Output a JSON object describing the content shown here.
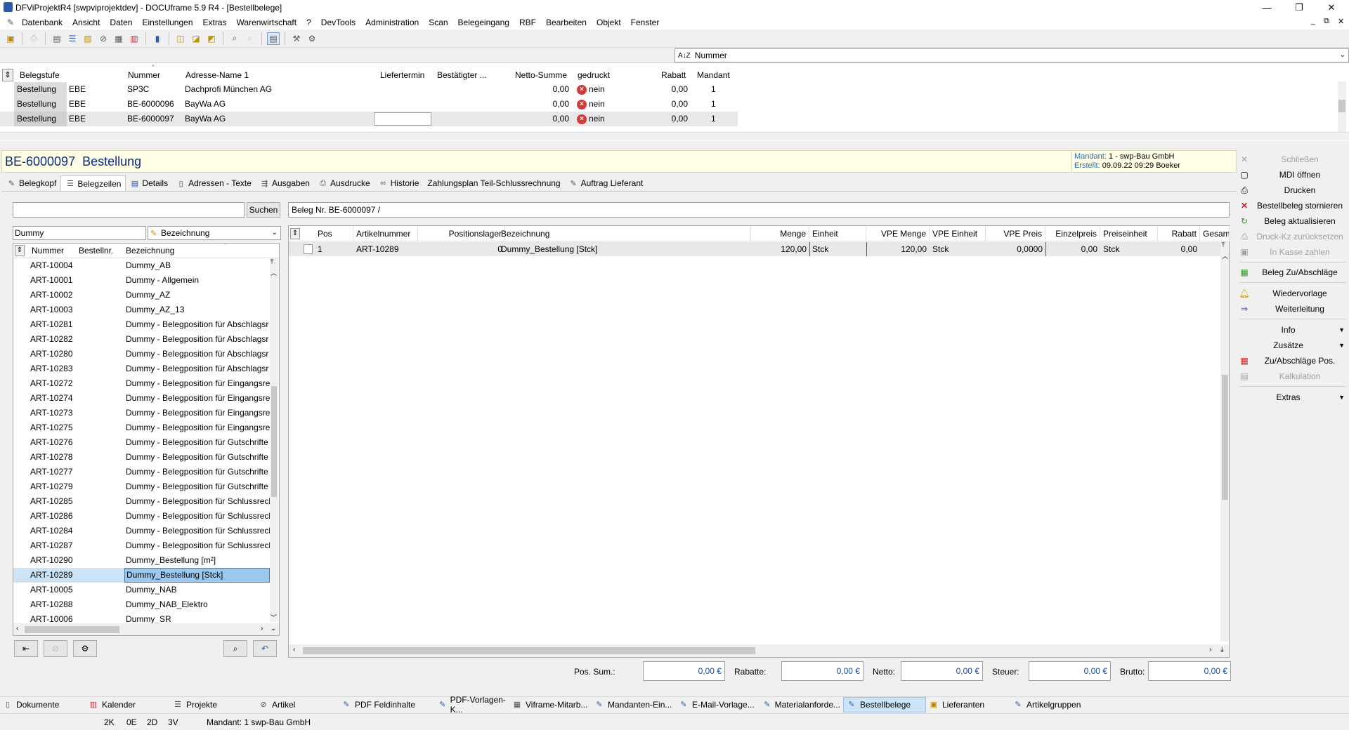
{
  "window": {
    "title": "DFViProjektR4 [swpviprojektdev] - DOCUframe 5.9 R4 - [Bestellbelege]",
    "minimize": "—",
    "maximize": "❐",
    "close": "✕",
    "inner_minimize": "_",
    "inner_restore": "⧉",
    "inner_close": "✕"
  },
  "menu": [
    "Datenbank",
    "Ansicht",
    "Daten",
    "Einstellungen",
    "Extras",
    "Warenwirtschaft",
    "?",
    "DevTools",
    "Administration",
    "Scan",
    "Belegeingang",
    "RBF",
    "Bearbeiten",
    "Objekt",
    "Fenster"
  ],
  "sortbar": {
    "label": "Nummer",
    "icon": "sort-az-icon"
  },
  "toplist": {
    "headers": [
      "Belegstufe",
      "Nummer",
      "Adresse-Name 1",
      "Liefertermin",
      "Bestätigter ...",
      "Netto-Summe",
      "gedruckt",
      "Rabatt",
      "Mandant"
    ],
    "rows": [
      {
        "stufe": "Bestellung",
        "typ": "EBE",
        "nummer": "SP3C",
        "adresse": "Dachprofi München AG",
        "liefertermin": "",
        "bestaetigt": "",
        "netto": "0,00",
        "gedruckt": "nein",
        "rabatt": "0,00",
        "mandant": "1"
      },
      {
        "stufe": "Bestellung",
        "typ": "EBE",
        "nummer": "BE-6000096",
        "adresse": "BayWa AG",
        "liefertermin": "",
        "bestaetigt": "",
        "netto": "0,00",
        "gedruckt": "nein",
        "rabatt": "0,00",
        "mandant": "1"
      },
      {
        "stufe": "Bestellung",
        "typ": "EBE",
        "nummer": "BE-6000097",
        "adresse": "BayWa AG",
        "liefertermin": "",
        "bestaetigt": "",
        "netto": "0,00",
        "gedruckt": "nein",
        "rabatt": "0,00",
        "mandant": "1"
      }
    ]
  },
  "beleg": {
    "nummer": "BE-6000097",
    "stufe": "Bestellung",
    "mandant_label": "Mandant:",
    "mandant_value": "1 - swp-Bau GmbH",
    "erstellt_label": "Erstellt:",
    "erstellt_value": "09.09.22 09:29  Boeker"
  },
  "tabs": [
    {
      "label": "Belegkopf",
      "icon": "pencil-icon"
    },
    {
      "label": "Belegzeilen",
      "icon": "lines-icon"
    },
    {
      "label": "Details",
      "icon": "details-icon"
    },
    {
      "label": "Adressen - Texte",
      "icon": "page-icon"
    },
    {
      "label": "Ausgaben",
      "icon": "output-icon"
    },
    {
      "label": "Ausdrucke",
      "icon": "printer-icon"
    },
    {
      "label": "Historie",
      "icon": "link-icon"
    },
    {
      "label": "Zahlungsplan Teil-Schlussrechnung",
      "icon": ""
    },
    {
      "label": "Auftrag Lieferant",
      "icon": "edit-icon"
    }
  ],
  "search": {
    "value": "",
    "button": "Suchen",
    "beleg_field": "Beleg Nr. BE-6000097 /"
  },
  "filter": {
    "value": "Dummy",
    "field_select": "Bezeichnung"
  },
  "leftlist": {
    "headers": [
      "Nummer",
      "Bestellnr.",
      "Bezeichnung"
    ],
    "rows": [
      [
        "ART-10004",
        "",
        "Dummy_AB"
      ],
      [
        "ART-10001",
        "",
        "Dummy - Allgemein"
      ],
      [
        "ART-10002",
        "",
        "Dummy_AZ"
      ],
      [
        "ART-10003",
        "",
        "Dummy_AZ_13"
      ],
      [
        "ART-10281",
        "",
        "Dummy - Belegposition für Abschlagsr"
      ],
      [
        "ART-10282",
        "",
        "Dummy - Belegposition für Abschlagsr"
      ],
      [
        "ART-10280",
        "",
        "Dummy - Belegposition für Abschlagsr"
      ],
      [
        "ART-10283",
        "",
        "Dummy - Belegposition für Abschlagsr"
      ],
      [
        "ART-10272",
        "",
        "Dummy - Belegposition für Eingangsre"
      ],
      [
        "ART-10274",
        "",
        "Dummy - Belegposition für Eingangsre"
      ],
      [
        "ART-10273",
        "",
        "Dummy - Belegposition für Eingangsre"
      ],
      [
        "ART-10275",
        "",
        "Dummy - Belegposition für Eingangsre"
      ],
      [
        "ART-10276",
        "",
        "Dummy - Belegposition für Gutschrifte"
      ],
      [
        "ART-10278",
        "",
        "Dummy - Belegposition für Gutschrifte"
      ],
      [
        "ART-10277",
        "",
        "Dummy - Belegposition für Gutschrifte"
      ],
      [
        "ART-10279",
        "",
        "Dummy - Belegposition für Gutschrifte"
      ],
      [
        "ART-10285",
        "",
        "Dummy - Belegposition für Schlussrech"
      ],
      [
        "ART-10286",
        "",
        "Dummy - Belegposition für Schlussrech"
      ],
      [
        "ART-10284",
        "",
        "Dummy - Belegposition für Schlussrech"
      ],
      [
        "ART-10287",
        "",
        "Dummy - Belegposition für Schlussrech"
      ],
      [
        "ART-10290",
        "",
        "Dummy_Bestellung [m²]"
      ],
      [
        "ART-10289",
        "",
        "Dummy_Bestellung [Stck]"
      ],
      [
        "ART-10005",
        "",
        "Dummy_NAB"
      ],
      [
        "ART-10288",
        "",
        "Dummy_NAB_Elektro"
      ],
      [
        "ART-10006",
        "",
        "Dummy_SR"
      ]
    ],
    "selected_index": 21
  },
  "grid": {
    "headers": [
      "Pos",
      "Artikelnummer",
      "Positionslager",
      "Bezeichnung",
      "Menge",
      "Einheit",
      "VPE Menge",
      "VPE Einheit",
      "VPE Preis",
      "Einzelpreis",
      "Preiseinheit",
      "Rabatt",
      "Gesam"
    ],
    "rows": [
      {
        "pos": "1",
        "artikel": "ART-10289",
        "lager": "0",
        "bez": "Dummy_Bestellung [Stck]",
        "menge": "120,00",
        "einheit": "Stck",
        "vpe_menge": "120,00",
        "vpe_einheit": "Stck",
        "vpe_preis": "0,0000",
        "einzelpreis": "0,00",
        "preiseinheit": "Stck",
        "rabatt": "0,00",
        "gesamt": ""
      }
    ]
  },
  "totals": {
    "pos_sum_label": "Pos. Sum.:",
    "pos_sum": "0,00 €",
    "rabatte_label": "Rabatte:",
    "rabatte": "0,00 €",
    "netto_label": "Netto:",
    "netto": "0,00 €",
    "steuer_label": "Steuer:",
    "steuer": "0,00 €",
    "brutto_label": "Brutto:",
    "brutto": "0,00 €"
  },
  "side_actions": [
    {
      "label": "Schließen",
      "icon": "close-icon",
      "enabled": false
    },
    {
      "label": "MDI öffnen",
      "icon": "window-icon",
      "enabled": true
    },
    {
      "label": "Drucken",
      "icon": "printer-icon",
      "enabled": true
    },
    {
      "label": "Bestellbeleg stornieren",
      "icon": "cancel-x-icon",
      "enabled": true
    },
    {
      "label": "Beleg aktualisieren",
      "icon": "refresh-icon",
      "enabled": true
    },
    {
      "label": "Druck-Kz zurücksetzen",
      "icon": "print-reset-icon",
      "enabled": false
    },
    {
      "label": "In Kasse zahlen",
      "icon": "cash-icon",
      "enabled": false
    },
    {
      "label": "Beleg Zu/Abschläge",
      "icon": "surcharge-icon",
      "enabled": true
    },
    {
      "label": "Wiedervorlage",
      "icon": "bell-icon",
      "enabled": true
    },
    {
      "label": "Weiterleitung",
      "icon": "forward-icon",
      "enabled": true
    },
    {
      "label": "Info",
      "icon": "",
      "enabled": true
    },
    {
      "label": "Zusätze",
      "icon": "",
      "enabled": true
    },
    {
      "label": "Zu/Abschläge Pos.",
      "icon": "surcharge-pos-icon",
      "enabled": true
    },
    {
      "label": "Kalkulation",
      "icon": "calc-icon",
      "enabled": false
    },
    {
      "label": "Extras",
      "icon": "",
      "enabled": true
    }
  ],
  "taskbar": [
    {
      "label": "Dokumente",
      "icon": "documents-icon"
    },
    {
      "label": "Kalender",
      "icon": "calendar-icon"
    },
    {
      "label": "Projekte",
      "icon": "projects-icon"
    },
    {
      "label": "Artikel",
      "icon": "article-icon"
    },
    {
      "label": "PDF Feldinhalte",
      "icon": "pdf-icon"
    },
    {
      "label": "PDF-Vorlagen-K...",
      "icon": "pdf-icon"
    },
    {
      "label": "Viframe-Mitarb...",
      "icon": "users-icon"
    },
    {
      "label": "Mandanten-Ein...",
      "icon": "settings-icon"
    },
    {
      "label": "E-Mail-Vorlage...",
      "icon": "mail-icon"
    },
    {
      "label": "Materialanforde...",
      "icon": "material-icon"
    },
    {
      "label": "Bestellbelege",
      "icon": "orders-icon"
    },
    {
      "label": "Lieferanten",
      "icon": "supplier-icon"
    },
    {
      "label": "Artikelgruppen",
      "icon": "groups-icon"
    }
  ],
  "statusbar": {
    "k": "2K",
    "e": "0E",
    "d": "2D",
    "v": "3V",
    "mandant": "Mandant: 1 swp-Bau GmbH"
  }
}
